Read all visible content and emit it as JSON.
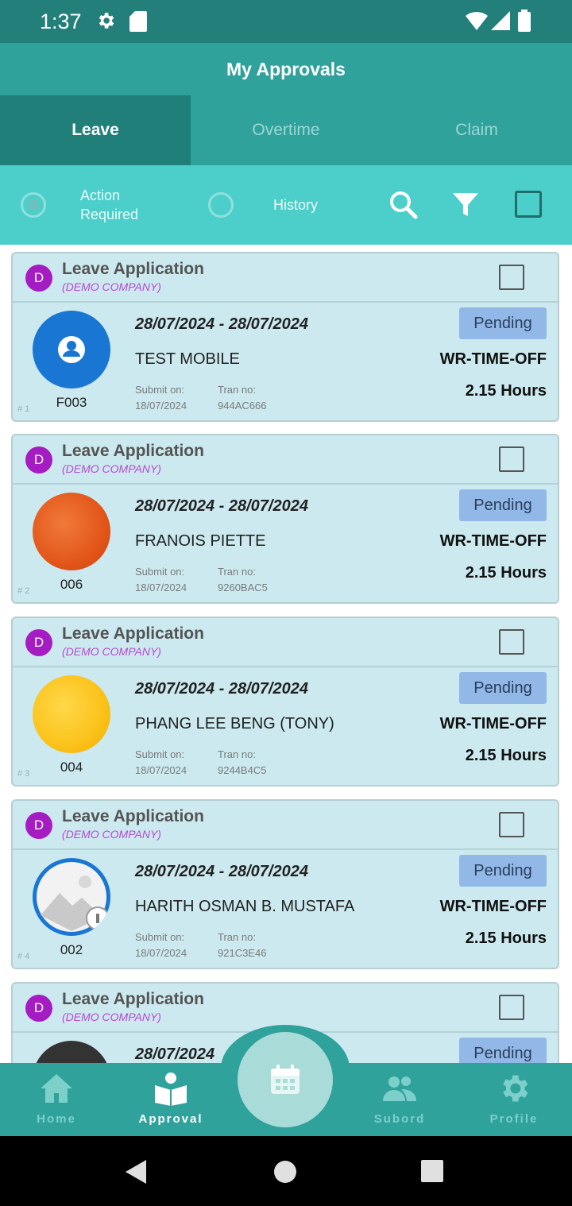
{
  "status_bar": {
    "time": "1:37"
  },
  "header": {
    "title": "My Approvals"
  },
  "tabs": [
    {
      "label": "Leave",
      "active": true
    },
    {
      "label": "Overtime",
      "active": false
    },
    {
      "label": "Claim",
      "active": false
    }
  ],
  "filter": {
    "options": [
      {
        "label": "Action Required",
        "selected": true
      },
      {
        "label": "History",
        "selected": false
      }
    ]
  },
  "cards": [
    {
      "index": "# 1",
      "badge": "D",
      "type": "Leave Application",
      "company": "(DEMO COMPANY)",
      "emp_id": "F003",
      "date_range": "28/07/2024 - 28/07/2024",
      "name": "TEST MOBILE",
      "submit_label": "Submit on:",
      "submit_date": "18/07/2024",
      "tran_label": "Tran no:",
      "tran_no": "944AC666",
      "status": "Pending",
      "leave_code": "WR-TIME-OFF",
      "amount": "2.15 Hours",
      "avatar": "default-user"
    },
    {
      "index": "# 2",
      "badge": "D",
      "type": "Leave Application",
      "company": "(DEMO COMPANY)",
      "emp_id": "006",
      "date_range": "28/07/2024 - 28/07/2024",
      "name": "FRANOIS PIETTE",
      "submit_label": "Submit on:",
      "submit_date": "18/07/2024",
      "tran_label": "Tran no:",
      "tran_no": "9260BAC5",
      "status": "Pending",
      "leave_code": "WR-TIME-OFF",
      "amount": "2.15 Hours",
      "avatar": "orange"
    },
    {
      "index": "# 3",
      "badge": "D",
      "type": "Leave Application",
      "company": "(DEMO COMPANY)",
      "emp_id": "004",
      "date_range": "28/07/2024 - 28/07/2024",
      "name": "PHANG LEE BENG (TONY)",
      "submit_label": "Submit on:",
      "submit_date": "18/07/2024",
      "tran_label": "Tran no:",
      "tran_no": "9244B4C5",
      "status": "Pending",
      "leave_code": "WR-TIME-OFF",
      "amount": "2.15 Hours",
      "avatar": "yellow"
    },
    {
      "index": "# 4",
      "badge": "D",
      "type": "Leave Application",
      "company": "(DEMO COMPANY)",
      "emp_id": "002",
      "date_range": "28/07/2024 - 28/07/2024",
      "name": "HARITH OSMAN B. MUSTAFA",
      "submit_label": "Submit on:",
      "submit_date": "18/07/2024",
      "tran_label": "Tran no:",
      "tran_no": "921C3E46",
      "status": "Pending",
      "leave_code": "WR-TIME-OFF",
      "amount": "2.15 Hours",
      "avatar": "image-placeholder"
    },
    {
      "index": "",
      "badge": "D",
      "type": "Leave Application",
      "company": "(DEMO COMPANY)",
      "emp_id": "",
      "date_range": "28/07/2024",
      "name": "",
      "submit_label": "",
      "submit_date": "",
      "tran_label": "",
      "tran_no": "",
      "status": "Pending",
      "leave_code": "",
      "amount": "",
      "avatar": "dark"
    }
  ],
  "bottom_nav": [
    {
      "label": "Home",
      "icon": "home-icon",
      "active": false
    },
    {
      "label": "Approval",
      "icon": "approval-icon",
      "active": true
    },
    {
      "label": "Subord",
      "icon": "people-icon",
      "active": false
    },
    {
      "label": "Profile",
      "icon": "gear-icon",
      "active": false
    }
  ],
  "colors": {
    "header": "#2fa29c",
    "tab_active": "#217f79",
    "filter_bar": "#4ccfca",
    "card_bg": "#cbe9ee",
    "pending": "#92b8e8",
    "badge": "#a51cc2"
  }
}
